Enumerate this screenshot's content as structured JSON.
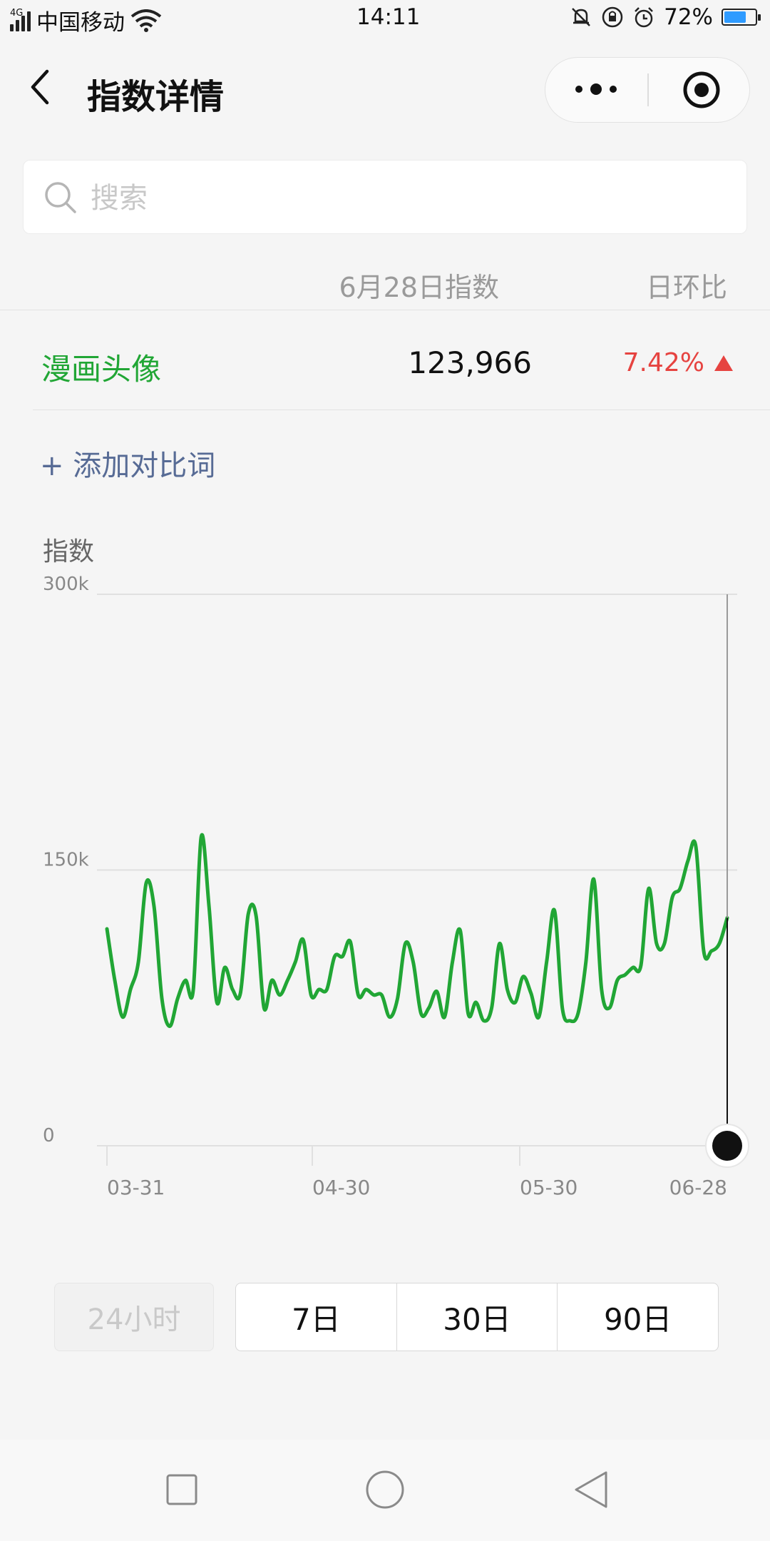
{
  "status_bar": {
    "network_tag": "4G",
    "carrier": "中国移动",
    "time": "14:11",
    "battery": "72%",
    "battery_level": 0.72
  },
  "header": {
    "title": "指数详情"
  },
  "search": {
    "placeholder": "搜索",
    "value": ""
  },
  "table": {
    "col_date": "6月28日指数",
    "col_ratio": "日环比",
    "rows": [
      {
        "keyword": "漫画头像",
        "value": "123,966",
        "change": "7.42%",
        "trend": "up"
      }
    ]
  },
  "add_compare": "+ 添加对比词",
  "colors": {
    "accent_green": "#21a635",
    "up_red": "#e64340",
    "link_blue": "#576b95"
  },
  "chart_data": {
    "type": "line",
    "ylabel": "指数",
    "yticks": [
      "300k",
      "150k",
      "0"
    ],
    "ylim": [
      0,
      300000
    ],
    "xticks": [
      "03-31",
      "04-30",
      "05-30",
      "06-28"
    ],
    "grid": true,
    "selected_point": "06-28",
    "series": [
      {
        "color": "#21a635",
        "values": [
          118000,
          90000,
          70000,
          85000,
          100000,
          143000,
          130000,
          80000,
          65000,
          80000,
          90000,
          85000,
          168000,
          130000,
          78000,
          97000,
          85000,
          83000,
          126000,
          125000,
          75000,
          90000,
          82000,
          90000,
          100000,
          112000,
          82000,
          85000,
          85000,
          103000,
          103000,
          111000,
          82000,
          85000,
          82000,
          82000,
          70000,
          80000,
          110000,
          100000,
          72000,
          75000,
          84000,
          70000,
          100000,
          117000,
          72000,
          78000,
          68000,
          75000,
          110000,
          85000,
          78000,
          92000,
          83000,
          70000,
          100000,
          128000,
          75000,
          68000,
          72000,
          100000,
          145000,
          85000,
          75000,
          90000,
          93000,
          97000,
          98000,
          140000,
          110000,
          110000,
          135000,
          140000,
          155000,
          163000,
          106000,
          106000,
          110000,
          124000
        ]
      }
    ]
  },
  "range_tabs": {
    "disabled_label": "24小时",
    "tabs": [
      "7日",
      "30日",
      "90日"
    ],
    "active_index": 2
  }
}
